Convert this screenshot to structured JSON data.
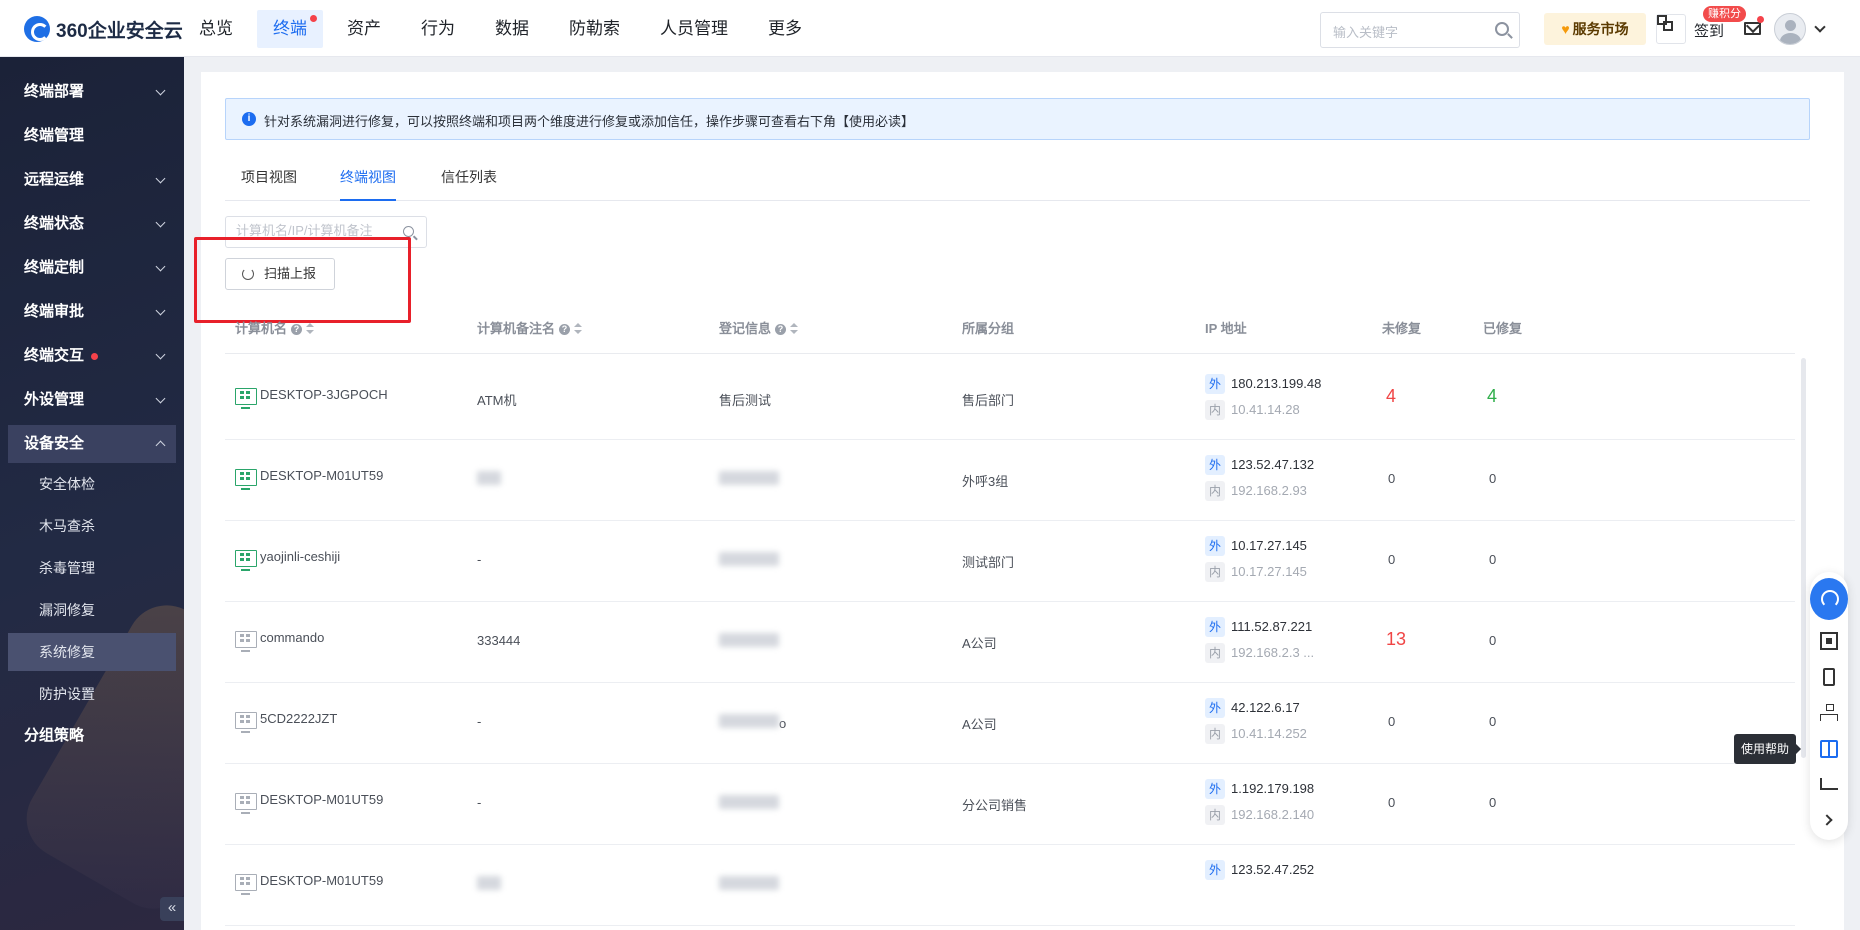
{
  "app": {
    "logo_text": "360企业安全云"
  },
  "topnav": {
    "items": [
      {
        "label": "总览"
      },
      {
        "label": "终端",
        "active": true,
        "dot": true
      },
      {
        "label": "资产"
      },
      {
        "label": "行为"
      },
      {
        "label": "数据"
      },
      {
        "label": "防勒索"
      },
      {
        "label": "人员管理"
      },
      {
        "label": "更多"
      }
    ],
    "search_placeholder": "输入关键字",
    "market_label": "服务市场",
    "points_badge": "赚积分",
    "checkin_label": "签到"
  },
  "sidebar": {
    "items": [
      {
        "label": "终端部署",
        "expandable": true
      },
      {
        "label": "终端管理"
      },
      {
        "label": "远程运维",
        "expandable": true
      },
      {
        "label": "终端状态",
        "expandable": true
      },
      {
        "label": "终端定制",
        "expandable": true
      },
      {
        "label": "终端审批",
        "expandable": true
      },
      {
        "label": "终端交互",
        "expandable": true,
        "dot": true
      },
      {
        "label": "外设管理",
        "expandable": true
      },
      {
        "label": "设备安全",
        "expanded": true
      }
    ],
    "subitems": [
      {
        "label": "安全体检"
      },
      {
        "label": "木马查杀"
      },
      {
        "label": "杀毒管理"
      },
      {
        "label": "漏洞修复"
      },
      {
        "label": "系统修复",
        "active": true
      },
      {
        "label": "防护设置"
      }
    ],
    "last_item": "分组策略",
    "collapse_label": "«"
  },
  "main": {
    "info_text": "针对系统漏洞进行修复，可以按照终端和项目两个维度进行修复或添加信任，操作步骤可查看右下角【使用必读】",
    "tabs": [
      {
        "label": "项目视图"
      },
      {
        "label": "终端视图",
        "active": true
      },
      {
        "label": "信任列表"
      }
    ],
    "search_placeholder": "计算机名/IP/计算机备注",
    "scan_button": "扫描上报",
    "columns": {
      "name": "计算机名",
      "remark": "计算机备注名",
      "register": "登记信息",
      "group": "所属分组",
      "ip": "IP 地址",
      "unfixed": "未修复",
      "fixed": "已修复"
    },
    "ip_ext_tag": "外",
    "ip_int_tag": "内",
    "rows": [
      {
        "name": "DESKTOP-3JGPOCH",
        "online": true,
        "remark": "ATM机",
        "register": "售后测试",
        "group": "售后部门",
        "ip_ext": "180.213.199.48",
        "ip_int": "10.41.14.28",
        "unfixed": "4",
        "fixed": "4",
        "unfixed_hl": true,
        "fixed_hl": true
      },
      {
        "name": "DESKTOP-M01UT59",
        "online": true,
        "remark": "",
        "register": "",
        "group": "外呼3组",
        "ip_ext": "123.52.47.132",
        "ip_int": "192.168.2.93",
        "unfixed": "0",
        "fixed": "0"
      },
      {
        "name": "yaojinli-ceshiji",
        "online": true,
        "remark": "-",
        "register": "",
        "group": "测试部门",
        "ip_ext": "10.17.27.145",
        "ip_int": "10.17.27.145",
        "unfixed": "0",
        "fixed": "0"
      },
      {
        "name": "commando",
        "online": false,
        "remark": "333444",
        "register": "",
        "group": "A公司",
        "ip_ext": "111.52.87.221",
        "ip_int": "192.168.2.3 ...",
        "unfixed": "13",
        "fixed": "0",
        "unfixed_hl": true
      },
      {
        "name": "5CD2222JZT",
        "online": false,
        "remark": "-",
        "register": "o",
        "group": "A公司",
        "ip_ext": "42.122.6.17",
        "ip_int": "10.41.14.252",
        "unfixed": "0",
        "fixed": "0"
      },
      {
        "name": "DESKTOP-M01UT59",
        "online": false,
        "remark": "-",
        "register": "",
        "group": "分公司销售",
        "ip_ext": "1.192.179.198",
        "ip_int": "192.168.2.140",
        "unfixed": "0",
        "fixed": "0"
      },
      {
        "name": "DESKTOP-M01UT59",
        "online": false,
        "remark": "",
        "register": "",
        "group": "",
        "ip_ext": "123.52.47.252",
        "ip_int": "",
        "unfixed": "",
        "fixed": ""
      }
    ]
  },
  "float_bar": {
    "tooltip": "使用帮助"
  },
  "colors": {
    "accent": "#1c6cf0",
    "danger": "#f04545",
    "success": "#2fae4a",
    "sidebar_bg": "#1b2238",
    "highlight_box": "#e8202a"
  }
}
